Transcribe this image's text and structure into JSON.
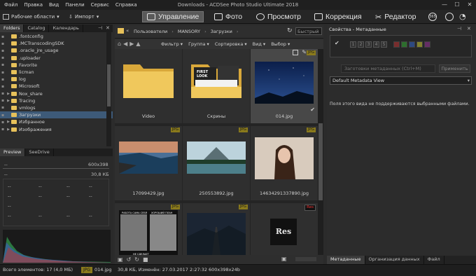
{
  "window": {
    "title": "Downloads - ACDSee Photo Studio Ultimate 2018",
    "controls": [
      "—",
      "☐",
      "✕"
    ]
  },
  "menu": [
    "Файл",
    "Правка",
    "Вид",
    "Панели",
    "Сервис",
    "Справка"
  ],
  "toolbar": {
    "workspaces": "Рабочие области",
    "import": "Импорт",
    "modes": [
      {
        "label": "Управление",
        "active": true
      },
      {
        "label": "Фото",
        "active": false
      },
      {
        "label": "Просмотр",
        "active": false
      },
      {
        "label": "Коррекция",
        "active": false
      },
      {
        "label": "Редактор",
        "active": false
      }
    ],
    "badge_365": "365"
  },
  "left_panel": {
    "tabs": [
      "Folders",
      "Catalog",
      "Календарь"
    ],
    "folders": [
      {
        "name": ".fontconfig",
        "expand": false,
        "selected": false
      },
      {
        "name": ".MCTranscodingSDK",
        "expand": false,
        "selected": false
      },
      {
        "name": ".oracle_jre_usage",
        "expand": false,
        "selected": false
      },
      {
        "name": ".uploader",
        "expand": false,
        "selected": false
      },
      {
        "name": "Favorite",
        "expand": false,
        "selected": false
      },
      {
        "name": "licman",
        "expand": false,
        "selected": false
      },
      {
        "name": "log",
        "expand": false,
        "selected": false
      },
      {
        "name": "Microsoft",
        "expand": false,
        "selected": false
      },
      {
        "name": "Nox_share",
        "expand": true,
        "selected": false
      },
      {
        "name": "Tracing",
        "expand": true,
        "selected": false
      },
      {
        "name": "vmlogs",
        "expand": false,
        "selected": false
      },
      {
        "name": "Загрузки",
        "expand": false,
        "selected": true
      },
      {
        "name": "Избранное",
        "expand": true,
        "selected": false
      },
      {
        "name": "Изображения",
        "expand": true,
        "selected": false
      }
    ]
  },
  "preview": {
    "tabs": [
      "Preview",
      "SeeDrive"
    ],
    "dashes": "--",
    "resolution": "600x398",
    "size": "30,8 КБ"
  },
  "path": {
    "crumbs": [
      "Пользователи",
      "MANSORY",
      "Загрузки"
    ],
    "quick": "Быстрый"
  },
  "filterbar": [
    "Фильтр",
    "Группа",
    "Сортировка",
    "Вид",
    "Выбор"
  ],
  "files": [
    {
      "name": "Video",
      "type": "folder",
      "badge": "",
      "selected": false
    },
    {
      "name": "Скрины",
      "type": "folder2",
      "badge": "",
      "selected": false
    },
    {
      "name": "014.jpg",
      "type": "night",
      "badge": "JPG",
      "selected": true
    },
    {
      "name": "17099429.jpg",
      "type": "coast",
      "badge": "JPG",
      "selected": false
    },
    {
      "name": "250553892.jpg",
      "type": "mountain",
      "badge": "JPG",
      "selected": false
    },
    {
      "name": "14634291337890.jpg",
      "type": "portrait",
      "badge": "JPG",
      "selected": false
    },
    {
      "name": "",
      "type": "meme",
      "badge": "JPG",
      "selected": false
    },
    {
      "name": "",
      "type": "road",
      "badge": "JPG",
      "selected": false
    },
    {
      "name": "",
      "type": "res",
      "badge": "Res",
      "selected": false
    }
  ],
  "folder2_thumb": {
    "first": "FIRST",
    "look": "LOOK"
  },
  "meme_thumb": {
    "left": "РАБОТА САМА СЕБЯ",
    "right": "ХОРОШИЙ ПЛАН",
    "bottom": "НЕ СДЕЛАЕТ"
  },
  "res_thumb": "Res",
  "right_panel": {
    "title": "Свойства - Метаданные",
    "ratings": [
      "1",
      "2",
      "3",
      "4",
      "5"
    ],
    "colors": [
      "#b33",
      "#3a3",
      "#36c",
      "#cc3",
      "#939"
    ],
    "presets_placeholder": "Заготовки метаданных (Ctrl+M)",
    "apply": "Применить",
    "view": "Default Metadata View",
    "unsupported": "Поля этого вида не поддерживаются выбранными файлами.",
    "bottom_tabs": [
      "Метаданные",
      "Организация данных",
      "Файл"
    ]
  },
  "status": {
    "total": "Всего элементов: 17  (4,0 МБ)",
    "type": "JPG",
    "file": "014.jpg",
    "info": "30,8 КБ, Изменён: 27.03.2017 2:27:32",
    "dims": "600x398x24b"
  }
}
